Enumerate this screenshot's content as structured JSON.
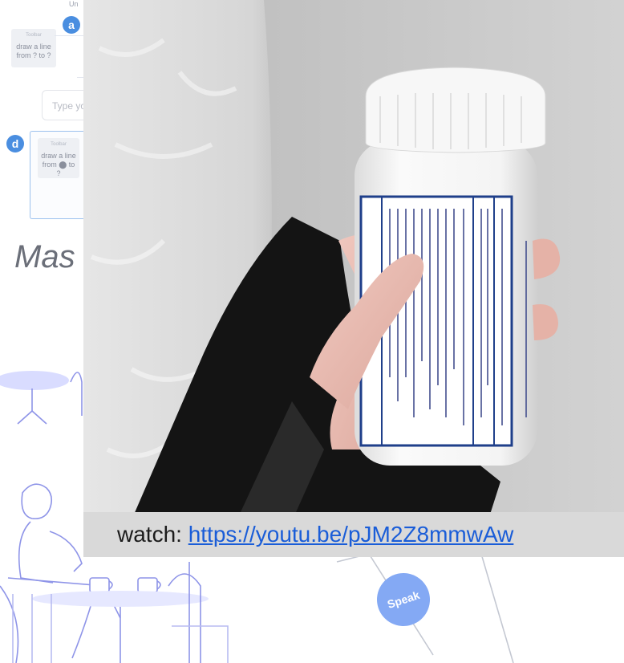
{
  "slide": {
    "undo_label": "Un",
    "badges": {
      "a": "a",
      "d": "d"
    },
    "card_a": {
      "caption": "Toolbar",
      "text": "draw a line from ? to ?"
    },
    "card_d": {
      "caption": "Toolbar",
      "text": "draw a line from ⬤ to ?"
    },
    "input_placeholder": "Type you",
    "heading": "Mas",
    "speak_label": "Speak"
  },
  "video": {
    "caption_prefix": "watch: ",
    "link_text": "https://youtu.be/pJM2Z8mmwAw",
    "link_href": "https://youtu.be/pJM2Z8mmwAw"
  }
}
